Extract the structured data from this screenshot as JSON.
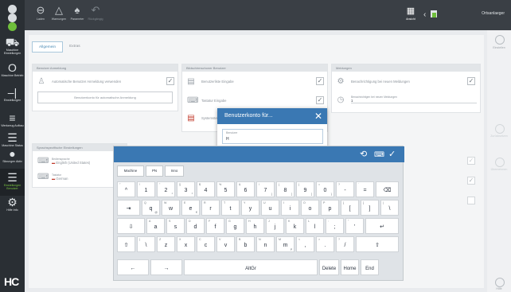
{
  "sidebar": {
    "items": [
      {
        "icon": "machine-icon",
        "glyph": "⛟",
        "label": "Maschine Einstellungen"
      },
      {
        "icon": "power-icon",
        "glyph": "O",
        "label": "Maschine Betrieb"
      },
      {
        "icon": "standby-icon",
        "glyph": "–|",
        "label": "Einstellungen"
      },
      {
        "icon": "menu-icon",
        "glyph": "≡",
        "label": "Werkzeug Aufbau"
      },
      {
        "icon": "list-icon",
        "glyph": "☰",
        "label": "Maschine Status"
      },
      {
        "icon": "dot-icon",
        "glyph": "●",
        "label": "Sitzungen Aktiv"
      },
      {
        "icon": "settings-icon",
        "glyph": "☰",
        "label": "Einstellungen Benutzer"
      },
      {
        "icon": "gear-icon",
        "glyph": "⚙",
        "label": "Hilfe Info"
      }
    ],
    "logo": "HC"
  },
  "topbar": {
    "buttons": [
      {
        "icon": "save-icon",
        "glyph": "⊖",
        "label": "Laden"
      },
      {
        "icon": "warning-icon",
        "glyph": "△",
        "label": "Warnungen"
      },
      {
        "icon": "tree-icon",
        "glyph": "♠",
        "label": "Parameter"
      },
      {
        "icon": "undo-icon",
        "glyph": "↶",
        "label": "Rückgängig"
      }
    ],
    "apps_label": "Ansicht",
    "user": "Ortsanlaeger"
  },
  "tabs": [
    {
      "label": "Allgemein",
      "selected": true
    },
    {
      "label": "Extras",
      "selected": false
    }
  ],
  "panels": {
    "left_top": {
      "title": "Benutzer Anmeldung",
      "row1": "Automatische Benutzer Anmeldung verwenden",
      "button": "Benutzerkonto für automatische Anmeldung"
    },
    "middle": {
      "title": "Bildschirmschoner Benutzer",
      "row1": "Benutzerliste Eingabe",
      "row2": "Tastatur Eingabe",
      "row3": "Systemsteuerung"
    },
    "right": {
      "title": "Meldungen",
      "row1": "Benachrichtigung bei neuen Meldungen",
      "row2_label": "Benachrichtigen bei neuen Meldungen",
      "row2_value": "1"
    },
    "left_bottom": {
      "title": "Sprachspezifische Einstellungen",
      "row1_label": "Bediensprache",
      "row1_value": "English (United States)",
      "row2_label": "Tastatur",
      "row2_value": "German"
    }
  },
  "rail": [
    {
      "label": "Einstellen"
    },
    {
      "label": "Zurücksetzen"
    },
    {
      "label": "Übernehmen"
    },
    {
      "label": "Hilfe"
    }
  ],
  "dialog": {
    "title": "Benutzerkonto für...",
    "field_label": "Benutzer",
    "field_value": "H"
  },
  "keyboard": {
    "lang_buttons": [
      "Machine",
      "PN",
      "Inno"
    ],
    "row1": [
      {
        "main": "^",
        "shift": "°"
      },
      {
        "main": "1",
        "shift": "!"
      },
      {
        "main": "2",
        "shift": "\"",
        "altgr": "²"
      },
      {
        "main": "3",
        "shift": "§",
        "altgr": "³"
      },
      {
        "main": "4",
        "shift": "$"
      },
      {
        "main": "5",
        "shift": "%"
      },
      {
        "main": "6",
        "shift": "&"
      },
      {
        "main": "7",
        "shift": "/",
        "altgr": "{"
      },
      {
        "main": "8",
        "shift": "(",
        "altgr": "["
      },
      {
        "main": "9",
        "shift": ")",
        "altgr": "]"
      },
      {
        "main": "0",
        "shift": "=",
        "altgr": "}"
      },
      {
        "main": "-",
        "shift": "?"
      },
      {
        "main": "=",
        "shift": "`"
      },
      {
        "main": "⌫",
        "shift": ""
      }
    ],
    "row2": [
      {
        "main": "⇥"
      },
      {
        "main": "q",
        "shift": "Q",
        "altgr": "@"
      },
      {
        "main": "w",
        "shift": "W"
      },
      {
        "main": "e",
        "shift": "E",
        "altgr": "€"
      },
      {
        "main": "r",
        "shift": "R"
      },
      {
        "main": "t",
        "shift": "T"
      },
      {
        "main": "y",
        "shift": "Y"
      },
      {
        "main": "u",
        "shift": "U"
      },
      {
        "main": "i",
        "shift": "I"
      },
      {
        "main": "o",
        "shift": "O"
      },
      {
        "main": "p",
        "shift": "P"
      },
      {
        "main": "[",
        "shift": "{"
      },
      {
        "main": "]",
        "shift": "}"
      },
      {
        "main": "\\",
        "shift": "|"
      }
    ],
    "row3": [
      {
        "main": "⇩"
      },
      {
        "main": "a",
        "shift": "A"
      },
      {
        "main": "s",
        "shift": "S"
      },
      {
        "main": "d",
        "shift": "D"
      },
      {
        "main": "f",
        "shift": "F"
      },
      {
        "main": "g",
        "shift": "G"
      },
      {
        "main": "h",
        "shift": "H"
      },
      {
        "main": "j",
        "shift": "J"
      },
      {
        "main": "k",
        "shift": "K"
      },
      {
        "main": "l",
        "shift": "L"
      },
      {
        "main": ";",
        "shift": ":"
      },
      {
        "main": "'",
        "shift": "\""
      },
      {
        "main": "↵"
      }
    ],
    "row4": [
      {
        "main": "⇧"
      },
      {
        "main": "\\",
        "shift": "|"
      },
      {
        "main": "z",
        "shift": "Z"
      },
      {
        "main": "x",
        "shift": "X"
      },
      {
        "main": "c",
        "shift": "C"
      },
      {
        "main": "v",
        "shift": "V"
      },
      {
        "main": "b",
        "shift": "B"
      },
      {
        "main": "n",
        "shift": "N"
      },
      {
        "main": "m",
        "shift": "M",
        "altgr": "µ"
      },
      {
        "main": ",",
        "shift": "<"
      },
      {
        "main": ".",
        "shift": ">"
      },
      {
        "main": "/",
        "shift": "?"
      },
      {
        "main": "⇧"
      }
    ],
    "row5": [
      {
        "main": "←"
      },
      {
        "main": "→"
      },
      {
        "main": "AltGr"
      },
      {
        "main": "Delete"
      },
      {
        "main": "Home"
      },
      {
        "main": "End"
      }
    ]
  }
}
